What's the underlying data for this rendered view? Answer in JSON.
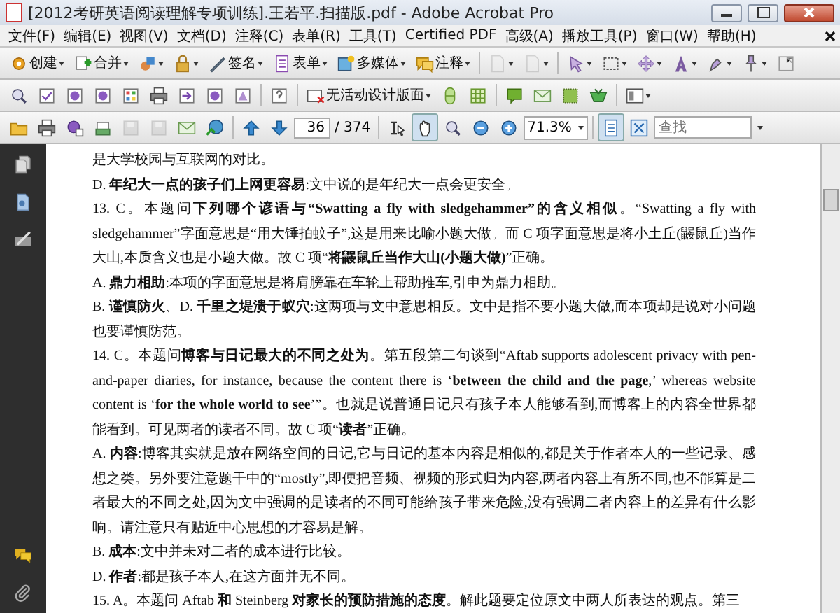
{
  "window": {
    "title": "[2012考研英语阅读理解专项训练].王若平.扫描版.pdf - Adobe Acrobat Pro"
  },
  "menu": [
    "文件(F)",
    "编辑(E)",
    "视图(V)",
    "文档(D)",
    "注释(C)",
    "表单(R)",
    "工具(T)",
    "Certified PDF",
    "高级(A)",
    "播放工具(P)",
    "窗口(W)",
    "帮助(H)"
  ],
  "task_buttons": [
    {
      "label": "创建"
    },
    {
      "label": "合并"
    },
    {
      "label": "签名"
    },
    {
      "label": "表单"
    },
    {
      "label": "多媒体"
    },
    {
      "label": "注释"
    }
  ],
  "design_dropdown": {
    "label": "无活动设计版面"
  },
  "navigation": {
    "page": "36",
    "page_count": "/ 374",
    "zoom": "71.3%",
    "search_placeholder": "查找"
  },
  "view_tools": [
    {
      "selected": false
    },
    {
      "selected": true
    },
    {
      "selected": false
    }
  ],
  "page_layout": [
    {
      "selected": true
    },
    {
      "selected": false
    }
  ],
  "document": {
    "paragraphs": [
      "是大学校园与互联网的对比。",
      "D. **年纪大一点的孩子们上网更容易**:文中说的是年纪大一点会更安全。",
      "13. C。本题问**下列哪个谚语与“Swatting a fly with sledgehammer”的含义相似**。“Swatting a fly with sledgehammer”字面意思是“用大锤拍蚊子”,这是用来比喻小题大做。而 C 项字面意思是将小土丘(鼹鼠丘)当作大山,本质含义也是小题大做。故 C 项“**将鼹鼠丘当作大山(小题大做)**”正确。",
      "A. **鼎力相助**:本项的字面意思是将肩膀靠在车轮上帮助推车,引申为鼎力相助。",
      "B. **谨慎防火**、D. **千里之堤溃于蚁穴**:这两项与文中意思相反。文中是指不要小题大做,而本项却是说对小问题也要谨慎防范。",
      "14. C。本题问**博客与日记最大的不同之处为**。第五段第二句谈到“Aftab supports adolescent privacy with pen-and-paper diaries, for instance, because the content there is ‘**between the child and the page**,’ whereas website content is ‘**for the whole world to see**’”。也就是说普通日记只有孩子本人能够看到,而博客上的内容全世界都能看到。可见两者的读者不同。故 C 项“**读者**”正确。",
      "A. **内容**:博客其实就是放在网络空间的日记,它与日记的基本内容是相似的,都是关于作者本人的一些记录、感想之类。另外要注意题干中的“mostly”,即便把音频、视频的形式归为内容,两者内容上有所不同,也不能算是二者最大的不同之处,因为文中强调的是读者的不同可能给孩子带来危险,没有强调二者内容上的差异有什么影响。请注意只有贴近中心思想的才容易是解。",
      "B. **成本**:文中并未对二者的成本进行比较。",
      "D. **作者**:都是孩子本人,在这方面并无不同。",
      "15. A。本题问 Aftab **和** Steinberg **对家长的预防措施的态度**。解此题要定位原文中两人所表达的观点。第三"
    ]
  }
}
